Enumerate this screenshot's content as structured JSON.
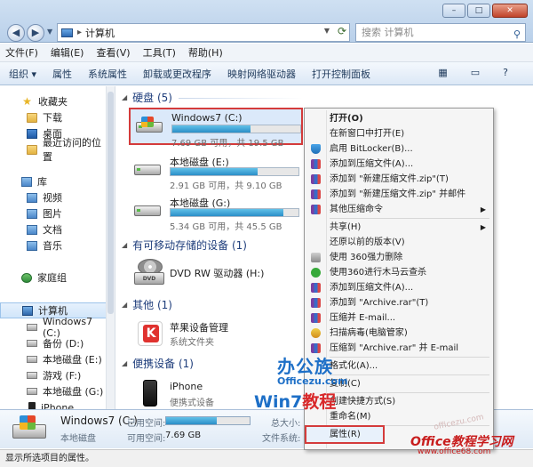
{
  "window": {
    "controls": [
      "–",
      "□",
      "✕"
    ],
    "address_path": "计算机",
    "search_placeholder": "搜索 计算机"
  },
  "menubar": [
    "文件(F)",
    "编辑(E)",
    "查看(V)",
    "工具(T)",
    "帮助(H)"
  ],
  "toolbar": {
    "organize": "组织 ▾",
    "items": [
      "属性",
      "系统属性",
      "卸载或更改程序",
      "映射网络驱动器",
      "打开控制面板"
    ]
  },
  "navpane": {
    "favorites": "收藏夹",
    "favorites_items": [
      "下载",
      "桌面",
      "最近访问的位置"
    ],
    "libraries": "库",
    "library_items": [
      "视频",
      "图片",
      "文档",
      "音乐"
    ],
    "homegroup": "家庭组",
    "computer": "计算机",
    "computer_items": [
      "Windows7 (C:)",
      "备份 (D:)",
      "本地磁盘 (E:)",
      "游戏 (F:)",
      "本地磁盘 (G:)",
      "iPhone"
    ]
  },
  "content": {
    "group_hdd": "硬盘 (5)",
    "drives": [
      {
        "name": "Windows7 (C:)",
        "info": "7.69 GB 可用，共 19.5 GB",
        "used_fraction": 0.61
      },
      {
        "name": "本地磁盘 (E:)",
        "info": "2.91 GB 可用，共 9.10 GB",
        "used_fraction": 0.68
      },
      {
        "name": "本地磁盘 (G:)",
        "info": "5.34 GB 可用，共 45.5 GB",
        "used_fraction": 0.88
      }
    ],
    "group_removable": "有可移动存储的设备 (1)",
    "dvd_name": "DVD RW 驱动器 (H:)",
    "group_other": "其他 (1)",
    "apple_name": "苹果设备管理",
    "apple_sub": "系统文件夹",
    "group_portable": "便携设备 (1)",
    "iphone_name": "iPhone",
    "iphone_sub": "便携式设备"
  },
  "context_menu": {
    "items": [
      {
        "label": "打开(O)",
        "bold": true
      },
      {
        "label": "在新窗口中打开(E)"
      },
      {
        "label": "启用 BitLocker(B)...",
        "icon": "shield-icon"
      },
      {
        "label": "添加到压缩文件(A)...",
        "icon": "winrar-icon"
      },
      {
        "label": "添加到 \"新建压缩文件.zip\"(T)",
        "icon": "winrar-icon"
      },
      {
        "label": "添加到 \"新建压缩文件.zip\" 并邮件",
        "icon": "winrar-icon"
      },
      {
        "label": "其他压缩命令",
        "icon": "winrar-icon",
        "submenu": true
      },
      {
        "sep": true
      },
      {
        "label": "共享(H)",
        "submenu": true
      },
      {
        "label": "还原以前的版本(V)"
      },
      {
        "label": "使用 360强力删除",
        "icon": "printer-icon"
      },
      {
        "label": "使用360进行木马云查杀",
        "icon": "360-icon"
      },
      {
        "label": "添加到压缩文件(A)...",
        "icon": "winrar-icon"
      },
      {
        "label": "添加到 \"Archive.rar\"(T)",
        "icon": "winrar-icon"
      },
      {
        "label": "压缩并 E-mail...",
        "icon": "winrar-icon"
      },
      {
        "label": "扫描病毒(电脑管家)",
        "icon": "qq-manager-icon"
      },
      {
        "label": "压缩到 \"Archive.rar\" 并 E-mail",
        "icon": "winrar-icon"
      },
      {
        "sep": true
      },
      {
        "label": "格式化(A)..."
      },
      {
        "sep": true
      },
      {
        "label": "复制(C)"
      },
      {
        "sep": true
      },
      {
        "label": "创建快捷方式(S)"
      },
      {
        "label": "重命名(M)"
      },
      {
        "sep": true
      },
      {
        "label": "属性(R)",
        "highlighted": true
      }
    ]
  },
  "details": {
    "name": "Windows7 (C:)",
    "type": "本地磁盘",
    "used_label": "已用空间:",
    "used_fraction": 0.61,
    "free_label": "可用空间:",
    "free_value": "7.69 GB",
    "total_label": "总大小:",
    "fs_label": "文件系统:"
  },
  "statusbar": "显示所选项目的属性。",
  "watermarks": {
    "w1": "办公族",
    "w2": "Officezu.com",
    "w3a": "Win7",
    "w3b": "教程",
    "w4": "Office教程学习网",
    "w5": "www.office68.com",
    "w6": "officezu.com"
  },
  "colors": {
    "selection_outline": "#d43b3b",
    "bar_fill": "#2b8ec7",
    "group_header": "#1e3d7b"
  }
}
